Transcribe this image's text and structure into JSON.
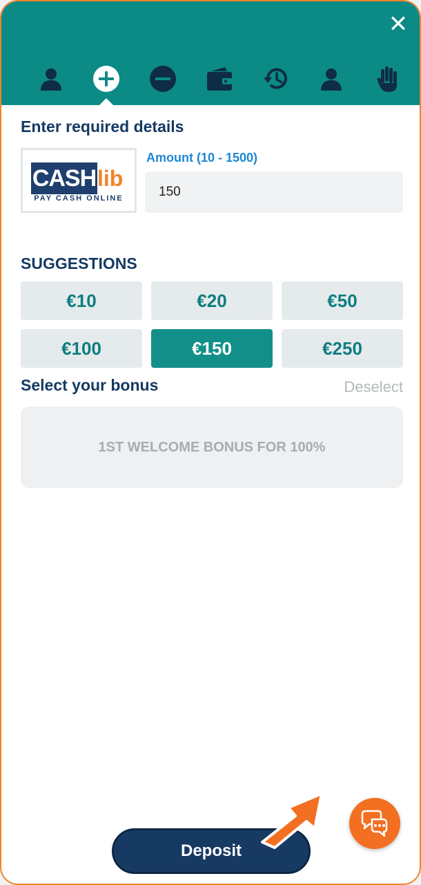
{
  "header": {
    "close_label": "✕",
    "nav_icons": [
      "profile-icon",
      "deposit-plus-icon",
      "withdraw-minus-icon",
      "wallet-icon",
      "history-icon",
      "account-icon",
      "hand-stop-icon"
    ],
    "active_index": 1
  },
  "form": {
    "title": "Enter required details",
    "payment_logo": {
      "main": "CASH",
      "accent": "lib",
      "tagline": "PAY CASH ONLINE"
    },
    "amount_label": "Amount (10 - 1500)",
    "amount_value": "150"
  },
  "suggestions": {
    "title": "SUGGESTIONS",
    "items": [
      "€10",
      "€20",
      "€50",
      "€100",
      "€150",
      "€250"
    ],
    "selected": "€150"
  },
  "bonus": {
    "title": "Select your bonus",
    "deselect_label": "Deselect",
    "card_label": "1ST WELCOME BONUS FOR 100%"
  },
  "footer": {
    "deposit_label": "Deposit",
    "chat_icon": "chat-bubbles-icon"
  },
  "colors": {
    "header": "#0b8a86",
    "navy": "#153a63",
    "accent_orange": "#f36f21",
    "chip_active": "#138f8a"
  }
}
